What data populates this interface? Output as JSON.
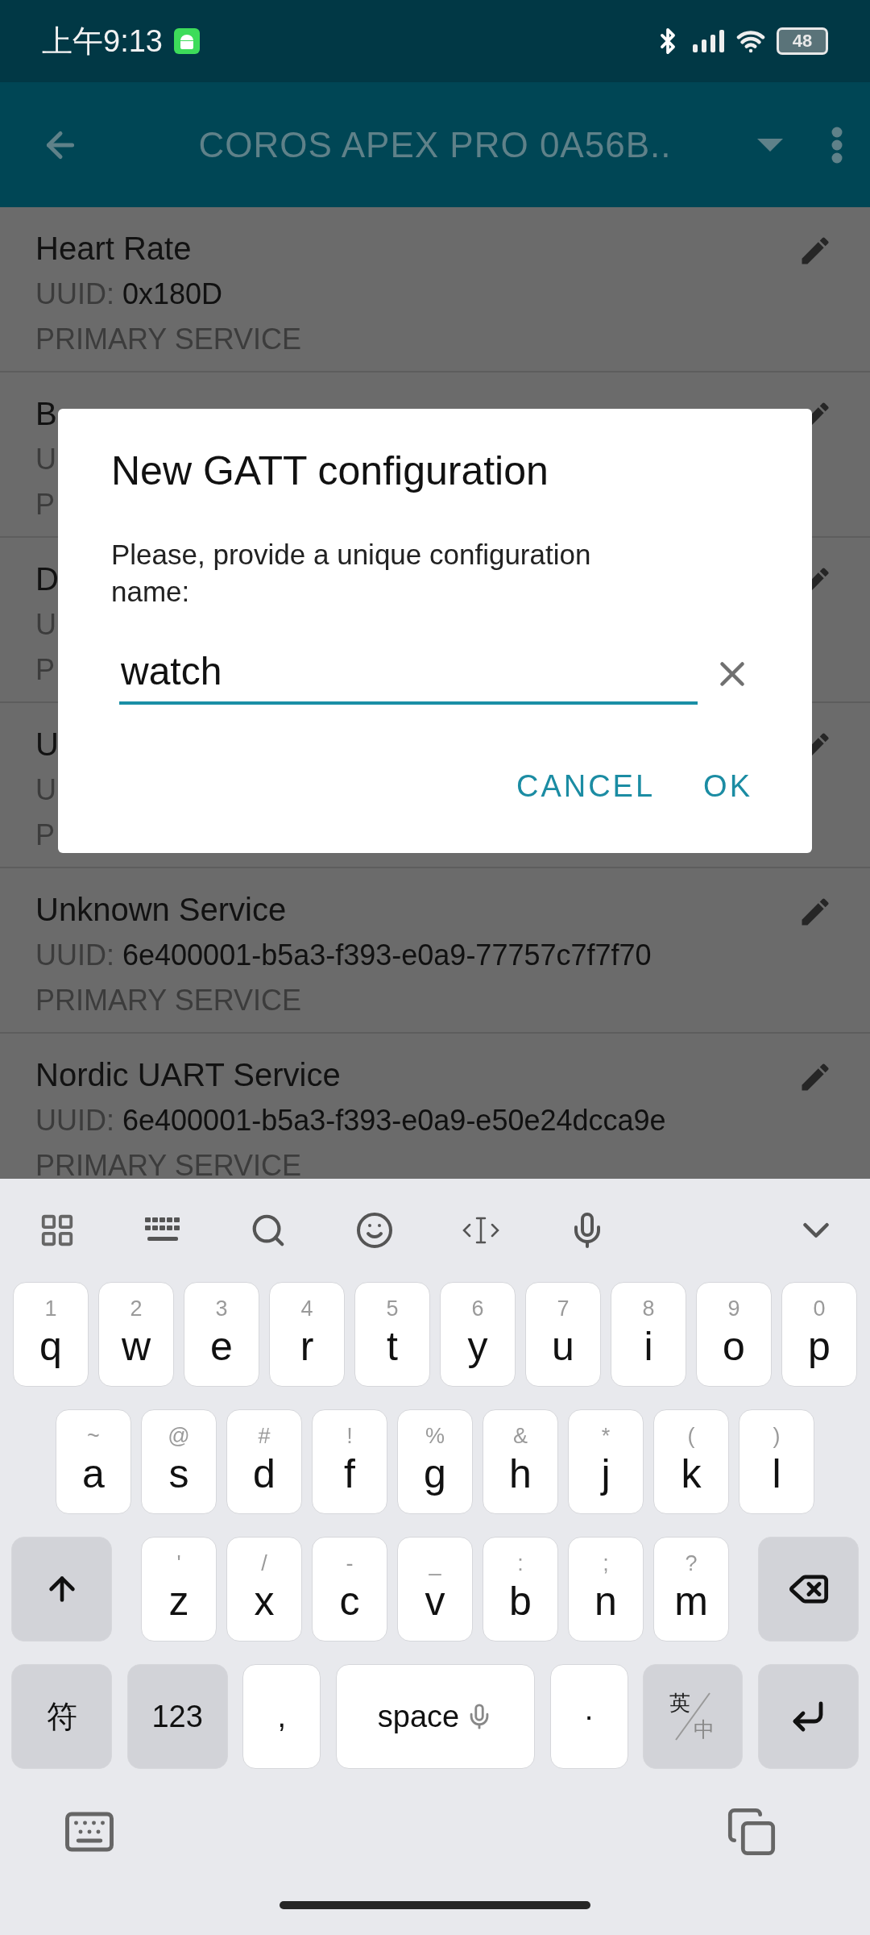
{
  "status_bar": {
    "time": "上午9:13",
    "battery": "48"
  },
  "app_bar": {
    "title": "COROS APEX PRO 0A56B.."
  },
  "services": [
    {
      "name": "Heart Rate",
      "uuid_label": "UUID:",
      "uuid": "0x180D",
      "type": "PRIMARY SERVICE"
    },
    {
      "name": "B",
      "uuid_label": "U",
      "type": "P"
    },
    {
      "name": "D",
      "uuid_label": "U",
      "type": "P"
    },
    {
      "name": "U",
      "uuid_label": "U",
      "type": "P"
    },
    {
      "name": "Unknown Service",
      "uuid_label": "UUID:",
      "uuid": "6e400001-b5a3-f393-e0a9-77757c7f7f70",
      "type": "PRIMARY SERVICE"
    },
    {
      "name": "Nordic UART Service",
      "uuid_label": "UUID:",
      "uuid": "6e400001-b5a3-f393-e0a9-e50e24dcca9e",
      "type": "PRIMARY SERVICE"
    }
  ],
  "dialog": {
    "title": "New GATT configuration",
    "message": "Please, provide a unique configuration name:",
    "field": {
      "value": "watch"
    },
    "buttons": [
      "CANCEL",
      "OK"
    ]
  },
  "keyboard": {
    "letter_rows": [
      [
        {
          "kind": "letter",
          "label": "q",
          "hint": "1"
        },
        {
          "kind": "letter",
          "label": "w",
          "hint": "2"
        },
        {
          "kind": "letter",
          "label": "e",
          "hint": "3"
        },
        {
          "kind": "letter",
          "label": "r",
          "hint": "4"
        },
        {
          "kind": "letter",
          "label": "t",
          "hint": "5"
        },
        {
          "kind": "letter",
          "label": "y",
          "hint": "6"
        },
        {
          "kind": "letter",
          "label": "u",
          "hint": "7"
        },
        {
          "kind": "letter",
          "label": "i",
          "hint": "8"
        },
        {
          "kind": "letter",
          "label": "o",
          "hint": "9"
        },
        {
          "kind": "letter",
          "label": "p",
          "hint": "0"
        }
      ],
      [
        {
          "kind": "letter",
          "label": "a",
          "hint": "~"
        },
        {
          "kind": "letter",
          "label": "s",
          "hint": "@"
        },
        {
          "kind": "letter",
          "label": "d",
          "hint": "#"
        },
        {
          "kind": "letter",
          "label": "f",
          "hint": "!"
        },
        {
          "kind": "letter",
          "label": "g",
          "hint": "%"
        },
        {
          "kind": "letter",
          "label": "h",
          "hint": "&"
        },
        {
          "kind": "letter",
          "label": "j",
          "hint": "*"
        },
        {
          "kind": "letter",
          "label": "k",
          "hint": "("
        },
        {
          "kind": "letter",
          "label": "l",
          "hint": ")"
        }
      ],
      [
        {
          "kind": "shift"
        },
        {
          "kind": "letter",
          "label": "z",
          "hint": "'"
        },
        {
          "kind": "letter",
          "label": "x",
          "hint": "/"
        },
        {
          "kind": "letter",
          "label": "c",
          "hint": "-"
        },
        {
          "kind": "letter",
          "label": "v",
          "hint": "_"
        },
        {
          "kind": "letter",
          "label": "b",
          "hint": ":"
        },
        {
          "kind": "letter",
          "label": "n",
          "hint": ";"
        },
        {
          "kind": "letter",
          "label": "m",
          "hint": "?"
        },
        {
          "kind": "backspace"
        }
      ]
    ],
    "bottom_row": [
      {
        "kind": "function",
        "label": "符"
      },
      {
        "kind": "function",
        "label": "123"
      },
      {
        "kind": "punct",
        "label": ","
      },
      {
        "kind": "space",
        "label": "space"
      },
      {
        "kind": "punct",
        "label": "·"
      },
      {
        "kind": "lang",
        "label": "英",
        "alt": "中"
      },
      {
        "kind": "enter"
      }
    ]
  }
}
